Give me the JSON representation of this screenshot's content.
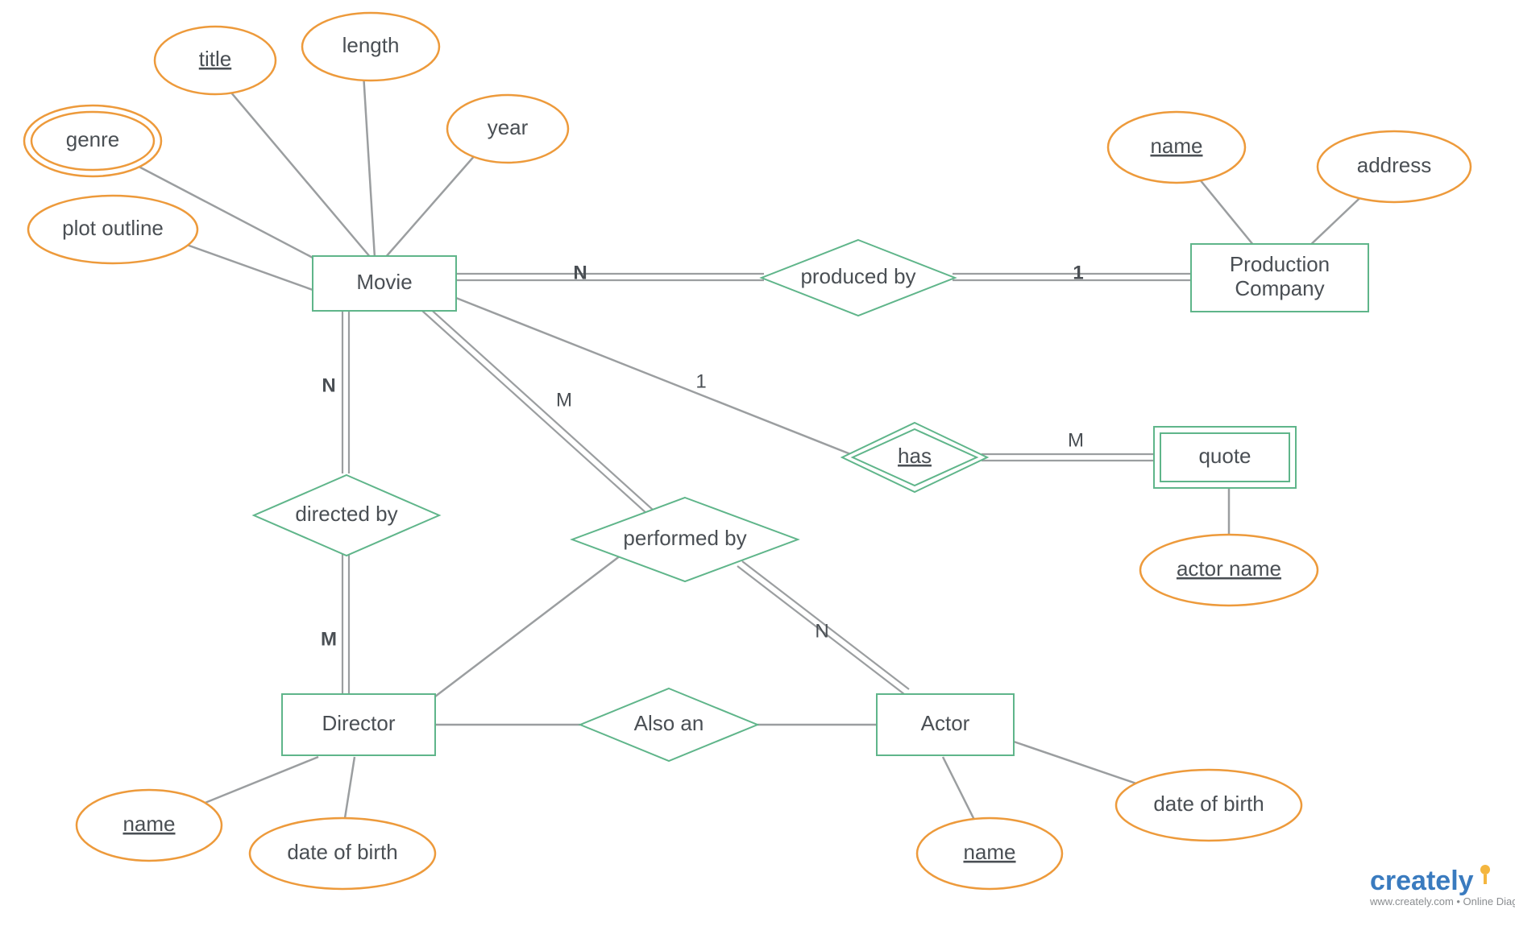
{
  "entities": {
    "movie": "Movie",
    "production_company_l1": "Production",
    "production_company_l2": "Company",
    "director": "Director",
    "actor": "Actor",
    "quote": "quote"
  },
  "relationships": {
    "produced_by": "produced by",
    "directed_by": "directed by",
    "performed_by": "performed by",
    "has": "has",
    "also_an": "Also an"
  },
  "attributes": {
    "title": "title",
    "length": "length",
    "year": "year",
    "genre": "genre",
    "plot_outline": "plot outline",
    "pc_name": "name",
    "pc_address": "address",
    "dir_name": "name",
    "dir_dob": "date of birth",
    "actor_name_attr": "name",
    "actor_dob": "date of birth",
    "quote_actor_name": "actor name"
  },
  "cardinalities": {
    "movie_produced": "N",
    "pc_produced": "1",
    "movie_directed": "N",
    "director_directed": "M",
    "movie_performed": "M",
    "actor_performed": "N",
    "movie_has": "1",
    "quote_has": "M"
  },
  "watermark": {
    "brand": "creately",
    "tagline": "www.creately.com • Online Diagramming"
  }
}
